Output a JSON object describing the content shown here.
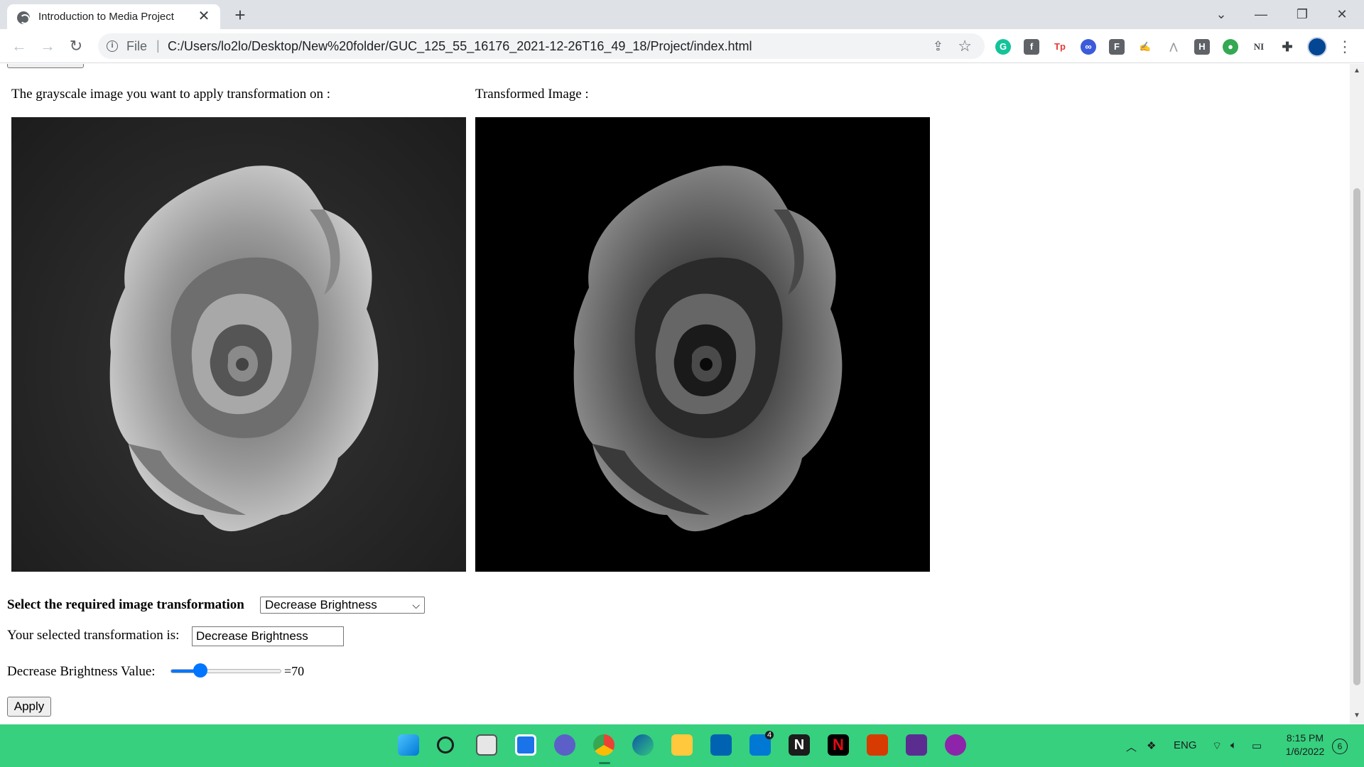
{
  "browser": {
    "tab_title": "Introduction to Media Project",
    "url_scheme": "File",
    "url": "C:/Users/lo2lo/Desktop/New%20folder/GUC_125_55_16176_2021-12-26T16_49_18/Project/index.html",
    "extensions": [
      "grammarly-icon",
      "facebook-icon",
      "tp-icon",
      "infinity-icon",
      "f-icon",
      "signature-icon",
      "adobe-icon",
      "h-icon",
      "globe-icon",
      "ni-icon",
      "puzzle-icon"
    ]
  },
  "page": {
    "left_caption": "The grayscale image you want to apply transformation on :",
    "right_caption": "Transformed Image :",
    "select_label": "Select the required image transformation",
    "select_value": "Decrease Brightness",
    "selected_label": "Your selected transformation is:",
    "selected_value": "Decrease Brightness",
    "slider_label": "Decrease Brightness Value:",
    "slider_value_text": "=70",
    "slider_fraction": 0.27,
    "apply_label": "Apply"
  },
  "taskbar": {
    "apps": [
      "start-icon",
      "search-icon",
      "task-view-icon",
      "widgets-icon",
      "teams-icon",
      "chrome-icon",
      "edge-icon",
      "file-explorer-icon",
      "store-icon",
      "mail-icon",
      "notion-icon",
      "netflix-icon",
      "office-icon",
      "visual-studio-icon",
      "podcast-icon"
    ],
    "mail_badge": "4",
    "language": "ENG",
    "time": "8:15 PM",
    "date": "1/6/2022",
    "notification_count": "6",
    "accent": "#36d07f"
  }
}
